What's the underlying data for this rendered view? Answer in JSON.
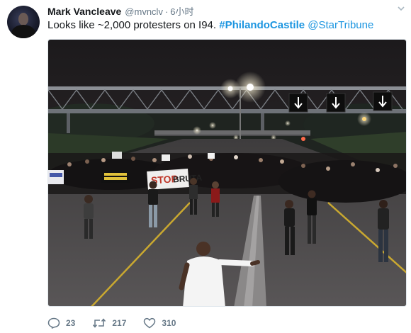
{
  "author": {
    "name": "Mark Vancleave",
    "handle": "@mvnclv",
    "time": "6小时"
  },
  "tweet": {
    "text_plain": "Looks like ~2,000 protesters on I94. ",
    "hashtag": "#PhilandoCastile",
    "mention": "@StarTribune"
  },
  "photo": {
    "protest_signs": [
      "STOP",
      "BRUTA"
    ]
  },
  "actions": {
    "replies": "23",
    "retweets": "217",
    "likes": "310"
  },
  "colors": {
    "link": "#1b95e0",
    "meta": "#657786"
  }
}
